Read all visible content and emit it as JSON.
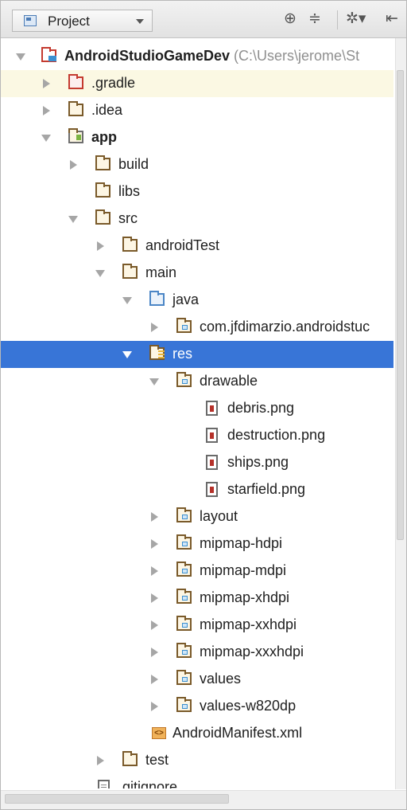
{
  "toolbar": {
    "view_label": "Project",
    "icons": [
      "target-icon",
      "collapse-all-icon",
      "gear-menu-icon",
      "hide-panel-icon"
    ]
  },
  "tree": {
    "project_name": "AndroidStudioGameDev",
    "project_path": "(C:\\Users\\jerome\\St",
    "gradle": ".gradle",
    "idea": ".idea",
    "app": "app",
    "build": "build",
    "libs": "libs",
    "src": "src",
    "androidTest": "androidTest",
    "main": "main",
    "java": "java",
    "package": "com.jfdimarzio.androidstuc",
    "res": "res",
    "drawable": "drawable",
    "debris": "debris.png",
    "destruction": "destruction.png",
    "ships": "ships.png",
    "starfield": "starfield.png",
    "layout": "layout",
    "mipmap_hdpi": "mipmap-hdpi",
    "mipmap_mdpi": "mipmap-mdpi",
    "mipmap_xhdpi": "mipmap-xhdpi",
    "mipmap_xxhdpi": "mipmap-xxhdpi",
    "mipmap_xxxhdpi": "mipmap-xxxhdpi",
    "values": "values",
    "values_w820dp": "values-w820dp",
    "manifest": "AndroidManifest.xml",
    "test": "test",
    "gitignore": ".gitignore"
  },
  "colors": {
    "selection": "#3875d7",
    "highlight_row": "#fbf8e3",
    "excluded_folder": "#c43a2f"
  }
}
